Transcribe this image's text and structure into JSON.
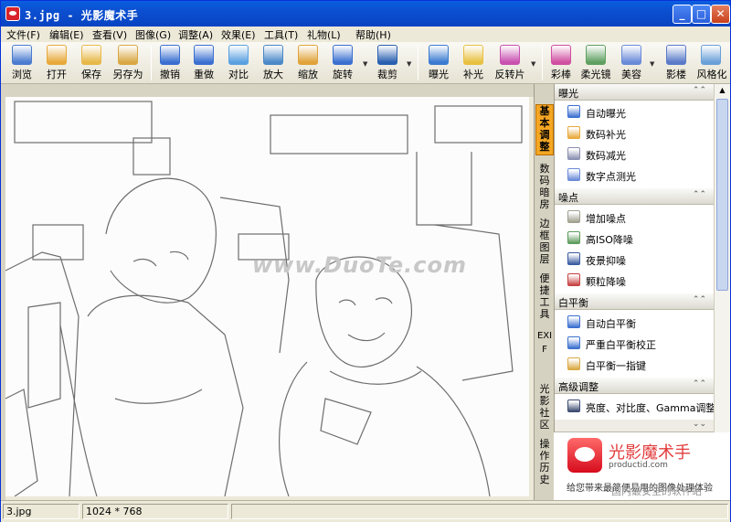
{
  "window": {
    "title": "3.jpg - 光影魔术手",
    "minimize": "_",
    "maximize": "□",
    "close": "✕"
  },
  "menu": [
    "文件(F)",
    "编辑(E)",
    "查看(V)",
    "图像(G)",
    "调整(A)",
    "效果(E)",
    "工具(T)",
    "礼物(L)",
    "帮助(H)"
  ],
  "toolbar": [
    {
      "label": "浏览",
      "icon": "browse-icon",
      "color": "#4a7bd0"
    },
    {
      "label": "打开",
      "icon": "open-folder-icon",
      "color": "#e8a93a"
    },
    {
      "label": "保存",
      "icon": "save-icon",
      "color": "#e7b84a"
    },
    {
      "label": "另存为",
      "icon": "save-as-icon",
      "color": "#d9a843"
    },
    {
      "label": "撤销",
      "icon": "undo-icon",
      "color": "#3a6fd0"
    },
    {
      "label": "重做",
      "icon": "redo-icon",
      "color": "#3a6fd0"
    },
    {
      "label": "对比",
      "icon": "compare-icon",
      "color": "#5aa0e0"
    },
    {
      "label": "放大",
      "icon": "zoom-in-icon",
      "color": "#4a88c8"
    },
    {
      "label": "缩放",
      "icon": "resize-icon",
      "color": "#e0a33a"
    },
    {
      "label": "旋转",
      "icon": "rotate-icon",
      "color": "#3a6fd0"
    },
    {
      "label": "裁剪",
      "icon": "crop-icon",
      "color": "#2a5fb0"
    },
    {
      "label": "曝光",
      "icon": "exposure-icon",
      "color": "#3a7ad0"
    },
    {
      "label": "补光",
      "icon": "fill-light-icon",
      "color": "#e8c040"
    },
    {
      "label": "反转片",
      "icon": "reversal-film-icon",
      "color": "#c84fb0"
    },
    {
      "label": "彩棒",
      "icon": "color-wand-icon",
      "color": "#d04fa0"
    },
    {
      "label": "柔光镜",
      "icon": "soft-focus-icon",
      "color": "#5fa060"
    },
    {
      "label": "美容",
      "icon": "beauty-icon",
      "color": "#6a8ad8"
    },
    {
      "label": "影楼",
      "icon": "studio-icon",
      "color": "#5a7ac8"
    },
    {
      "label": "风格化",
      "icon": "stylize-icon",
      "color": "#6aa0d8"
    }
  ],
  "side_tabs": [
    "基本调整",
    "数码暗房",
    "边框图层",
    "便捷工具",
    "EXIF",
    "光影社区",
    "操作历史"
  ],
  "watermark": "www.DuoTe.com",
  "panel": {
    "sections": [
      {
        "title": "曝光",
        "items": [
          {
            "label": "自动曝光",
            "icon": "auto-exposure-icon",
            "color": "#3a6fd0"
          },
          {
            "label": "数码补光",
            "icon": "digital-fill-icon",
            "color": "#e8a93a"
          },
          {
            "label": "数码减光",
            "icon": "digital-dim-icon",
            "color": "#8a8fb0"
          },
          {
            "label": "数字点测光",
            "icon": "spot-meter-icon",
            "color": "#6a8ad8"
          }
        ]
      },
      {
        "title": "噪点",
        "items": [
          {
            "label": "增加噪点",
            "icon": "add-noise-icon",
            "color": "#a0a090"
          },
          {
            "label": "高ISO降噪",
            "icon": "iso-denoise-icon",
            "color": "#5a9a5a"
          },
          {
            "label": "夜景抑噪",
            "icon": "night-denoise-icon",
            "color": "#3a5aa0"
          },
          {
            "label": "颗粒降噪",
            "icon": "grain-denoise-icon",
            "color": "#c84040"
          }
        ]
      },
      {
        "title": "白平衡",
        "items": [
          {
            "label": "自动白平衡",
            "icon": "auto-wb-icon",
            "color": "#3a6fd0"
          },
          {
            "label": "严重白平衡校正",
            "icon": "severe-wb-icon",
            "color": "#3a6fd0"
          },
          {
            "label": "白平衡一指键",
            "icon": "wb-picker-icon",
            "color": "#d9a843"
          }
        ]
      },
      {
        "title": "高级调整",
        "items": [
          {
            "label": "亮度、对比度、Gamma调整",
            "icon": "brightness-icon",
            "color": "#3a4a70"
          }
        ]
      }
    ]
  },
  "ad": {
    "title": "光影魔术手",
    "subtitle": "productid.com",
    "tagline": "给您带来最简便易用的图像处理体验"
  },
  "status": {
    "filename": "3.jpg",
    "dimensions": "1024 * 768"
  },
  "corner_watermark": "国内最安全的软件站"
}
